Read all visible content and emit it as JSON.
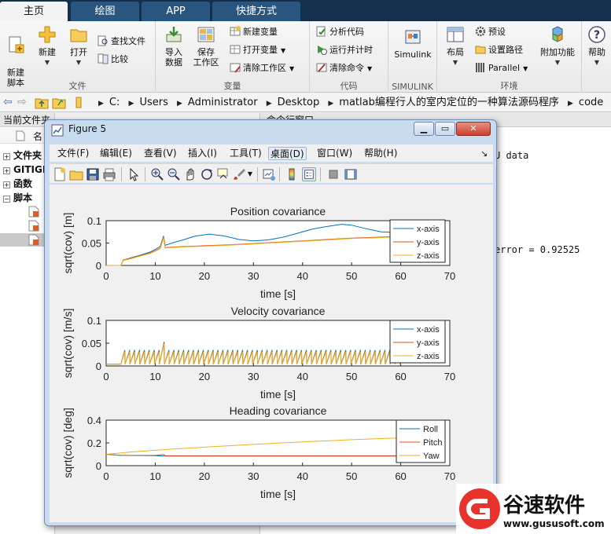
{
  "tabs": [
    "主页",
    "绘图",
    "APP",
    "快捷方式"
  ],
  "ribbon": {
    "file": {
      "label": "文件",
      "new_script": "新建\n脚本",
      "new": "新建",
      "open": "打开",
      "find_files": "查找文件",
      "compare": "比较"
    },
    "variable": {
      "label": "变量",
      "import_data": "导入\n数据",
      "save_workspace": "保存\n工作区",
      "new_variable": "新建变量",
      "open_variable": "打开变量",
      "clear_workspace": "清除工作区"
    },
    "code": {
      "label": "代码",
      "analyze": "分析代码",
      "run_time": "运行并计时",
      "clear_commands": "清除命令"
    },
    "simulink": {
      "label": "SIMULINK",
      "simulink": "Simulink"
    },
    "environment": {
      "label": "环境",
      "layout": "布局",
      "preferences": "预设",
      "set_path": "设置路径",
      "parallel": "Parallel",
      "addons": "附加功能"
    },
    "resources": {
      "help": "帮助"
    }
  },
  "address": {
    "crumbs": [
      "C:",
      "Users",
      "Administrator",
      "Desktop",
      "matlab编程行人的室内定位的一种算法源码程序",
      "code"
    ]
  },
  "left_panel": {
    "title": "当前文件夹",
    "name_col": "名",
    "items": [
      "文件夹",
      "GITIGN",
      "函数",
      "脚本"
    ]
  },
  "command_window": {
    "title": "命令行窗口",
    "line1": "U data",
    "line2": "error = 0.92525"
  },
  "figure": {
    "title": "Figure 5",
    "menus": [
      "文件(F)",
      "编辑(E)",
      "查看(V)",
      "插入(I)",
      "工具(T)",
      "桌面(D)",
      "窗口(W)",
      "帮助(H)"
    ]
  },
  "colors": {
    "series1": "#0072bd",
    "series2": "#d95319",
    "series3": "#edb120",
    "ribbon_tab_bg": "#13314f"
  },
  "chart_data": [
    {
      "type": "line",
      "title": "Position covariance",
      "xlabel": "time [s]",
      "ylabel": "sqrt(cov) [m]",
      "xlim": [
        0,
        70
      ],
      "ylim": [
        0,
        0.1
      ],
      "xticks": [
        0,
        10,
        20,
        30,
        40,
        50,
        60,
        70
      ],
      "yticks": [
        0,
        0.05,
        0.1
      ],
      "ytick_labels": [
        "0",
        "0.05",
        "0.1"
      ],
      "legend_position": "bottom-right",
      "series": [
        {
          "name": "x-axis",
          "x": [
            0,
            3,
            3.5,
            5,
            7,
            9,
            11,
            11.7,
            12,
            14,
            16,
            18,
            21,
            24,
            27,
            30,
            33,
            36,
            39,
            42,
            45,
            48,
            50,
            53,
            56,
            58,
            60
          ],
          "y": [
            0,
            0,
            0.012,
            0.017,
            0.023,
            0.03,
            0.042,
            0.066,
            0.045,
            0.052,
            0.058,
            0.065,
            0.07,
            0.066,
            0.058,
            0.055,
            0.057,
            0.063,
            0.072,
            0.081,
            0.087,
            0.092,
            0.09,
            0.082,
            0.075,
            0.074,
            0.075
          ]
        },
        {
          "name": "y-axis",
          "x": [
            0,
            3,
            3.5,
            5,
            7,
            9,
            11,
            11.7,
            12,
            15,
            20,
            25,
            30,
            35,
            40,
            45,
            50,
            55,
            60
          ],
          "y": [
            0,
            0,
            0.012,
            0.016,
            0.022,
            0.028,
            0.038,
            0.064,
            0.04,
            0.042,
            0.044,
            0.046,
            0.049,
            0.052,
            0.055,
            0.058,
            0.061,
            0.063,
            0.065
          ]
        },
        {
          "name": "z-axis",
          "x": [
            0,
            3,
            3.5,
            5,
            7,
            9,
            11,
            11.7,
            12,
            15,
            20,
            25,
            30,
            35,
            40,
            45,
            50,
            55,
            60
          ],
          "y": [
            0,
            0,
            0.011,
            0.015,
            0.021,
            0.027,
            0.037,
            0.062,
            0.039,
            0.041,
            0.043,
            0.045,
            0.048,
            0.051,
            0.054,
            0.057,
            0.06,
            0.062,
            0.064
          ]
        }
      ]
    },
    {
      "type": "line",
      "title": "Velocity covariance",
      "xlabel": "time [s]",
      "ylabel": "sqrt(cov) [m/s]",
      "xlim": [
        0,
        70
      ],
      "ylim": [
        0,
        0.1
      ],
      "xticks": [
        0,
        10,
        20,
        30,
        40,
        50,
        60,
        70
      ],
      "yticks": [
        0,
        0.05,
        0.1
      ],
      "ytick_labels": [
        "0",
        "0.05",
        "0.1"
      ],
      "legend_position": "bottom-right",
      "sawtooth": {
        "start": 3,
        "end": 60,
        "period": 1.0,
        "baseline": 0.004,
        "peak": 0.035,
        "big_peak_time": 11.7,
        "big_peak": 0.053
      },
      "series": [
        {
          "name": "x-axis"
        },
        {
          "name": "y-axis"
        },
        {
          "name": "z-axis"
        }
      ]
    },
    {
      "type": "line",
      "title": "Heading covariance",
      "xlabel": "time [s]",
      "ylabel": "sqrt(cov) [deg]",
      "xlim": [
        0,
        70
      ],
      "ylim": [
        0,
        0.4
      ],
      "xticks": [
        0,
        10,
        20,
        30,
        40,
        50,
        60,
        70
      ],
      "yticks": [
        0,
        0.2,
        0.4
      ],
      "ytick_labels": [
        "0",
        "0.2",
        "0.4"
      ],
      "legend_position": "bottom-right",
      "series": [
        {
          "name": "Roll",
          "x": [
            0,
            3,
            10,
            12,
            20,
            30,
            40,
            50,
            60
          ],
          "y": [
            0.1,
            0.09,
            0.088,
            0.085,
            0.085,
            0.085,
            0.085,
            0.085,
            0.085
          ]
        },
        {
          "name": "Pitch",
          "x": [
            0,
            3,
            10,
            11.7,
            12,
            20,
            30,
            40,
            50,
            60
          ],
          "y": [
            0.1,
            0.092,
            0.09,
            0.098,
            0.087,
            0.087,
            0.087,
            0.087,
            0.087,
            0.087
          ]
        },
        {
          "name": "Yaw",
          "x": [
            0,
            5,
            10,
            15,
            20,
            25,
            30,
            35,
            40,
            45,
            50,
            55,
            60
          ],
          "y": [
            0.1,
            0.12,
            0.135,
            0.15,
            0.163,
            0.175,
            0.187,
            0.198,
            0.208,
            0.218,
            0.228,
            0.236,
            0.244
          ]
        }
      ]
    }
  ],
  "watermark": {
    "brand_cn": "谷速软件",
    "site": "www.gususoft.com"
  }
}
